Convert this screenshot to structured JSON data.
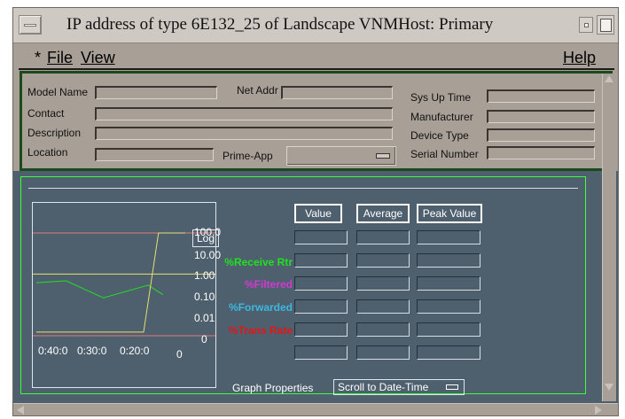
{
  "window": {
    "title": "IP address of type 6E132_25 of Landscape VNMHost: Primary"
  },
  "menubar": {
    "modified_marker": "*",
    "file": "File",
    "view": "View",
    "help": "Help"
  },
  "info": {
    "model_name": {
      "label": "Model Name",
      "value": ""
    },
    "net_addr": {
      "label": "Net Addr",
      "value": ""
    },
    "sys_up_time": {
      "label": "Sys Up Time",
      "value": ""
    },
    "contact": {
      "label": "Contact",
      "value": ""
    },
    "manufacturer": {
      "label": "Manufacturer",
      "value": ""
    },
    "description": {
      "label": "Description",
      "value": ""
    },
    "device_type": {
      "label": "Device Type",
      "value": ""
    },
    "location": {
      "label": "Location",
      "value": ""
    },
    "prime_app": {
      "label": "Prime-App",
      "value": ""
    },
    "serial_number": {
      "label": "Serial Number",
      "value": ""
    }
  },
  "graph": {
    "log_button": "Log",
    "column_headers": [
      "Value",
      "Average",
      "Peak Value"
    ],
    "metrics": [
      {
        "label": "%Receive Rtr",
        "color": "#22e022"
      },
      {
        "label": "%Filtered",
        "color": "#d23ad2"
      },
      {
        "label": "%Forwarded",
        "color": "#3cb8e0"
      },
      {
        "label": "%Trans Rate",
        "color": "#e01818"
      }
    ],
    "graph_properties_label": "Graph Properties",
    "scroll_button": "Scroll to Date-Time"
  },
  "chart_data": {
    "type": "line",
    "yscale": "log",
    "y_tick_labels": [
      "100.0",
      "10.00",
      "1.00",
      "0.10",
      "0.01",
      "0"
    ],
    "x_tick_labels": [
      "0:40:0",
      "0:30:0",
      "0:20:0",
      "0"
    ],
    "series": [
      {
        "color": "#22e022",
        "points": [
          [
            0,
            0.38
          ],
          [
            0.2,
            0.47
          ],
          [
            0.45,
            0.07
          ],
          [
            0.75,
            0.29
          ],
          [
            0.85,
            0.1
          ]
        ]
      },
      {
        "color": "#e6e070",
        "points": [
          [
            0,
            0.0015
          ],
          [
            0.72,
            0.0015
          ],
          [
            0.82,
            100
          ],
          [
            1.0,
            100
          ]
        ]
      }
    ],
    "reference_lines": [
      {
        "color": "#e07a7a",
        "y": 100
      },
      {
        "color": "#e6e070",
        "y": 1
      },
      {
        "color": "#e07a7a",
        "y": 0
      }
    ]
  }
}
